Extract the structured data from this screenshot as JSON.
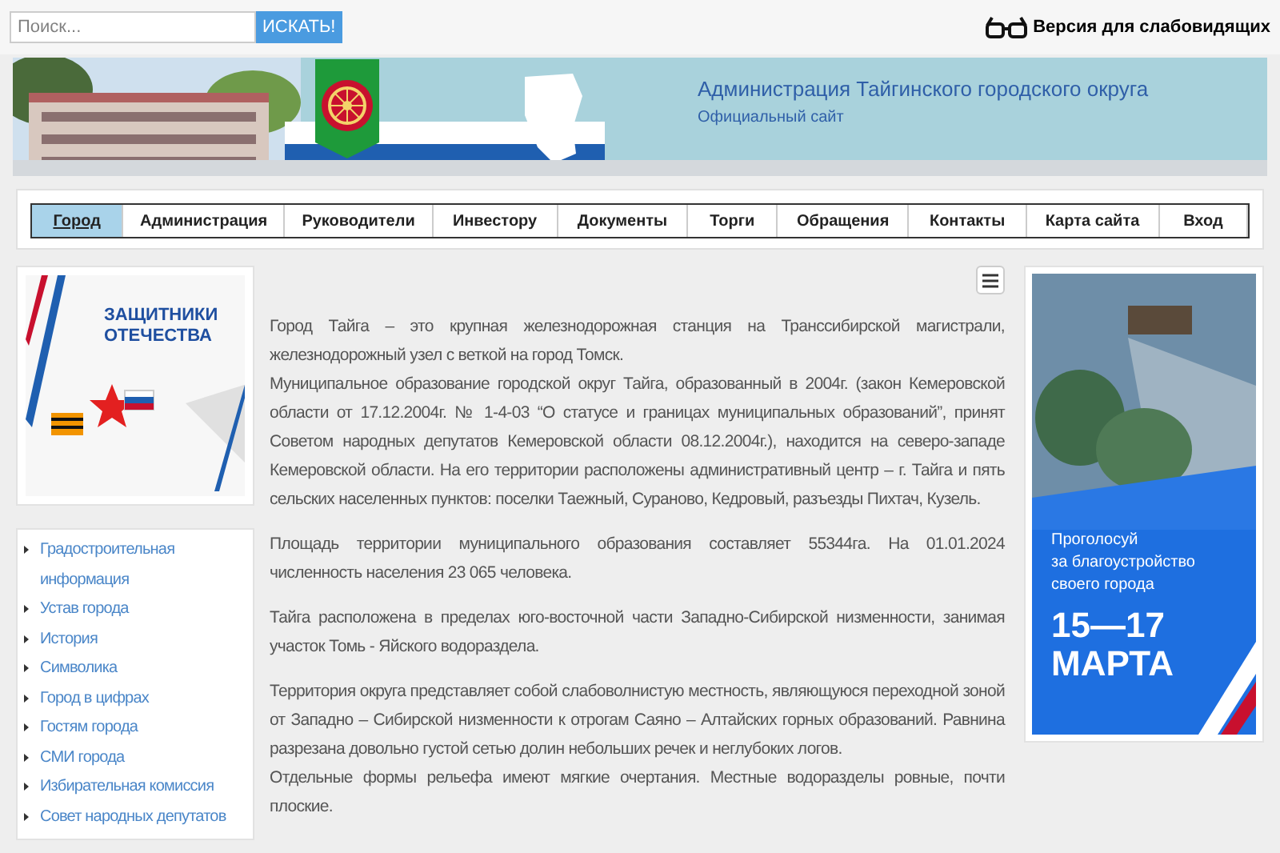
{
  "search": {
    "placeholder": "Поиск...",
    "button": "ИСКАТЬ!"
  },
  "accessibility_link": "Версия для слабовидящих",
  "header": {
    "title": "Администрация Тайгинского городского округа",
    "subtitle": "Официальный сайт"
  },
  "nav": [
    {
      "label": "Город",
      "selected": true
    },
    {
      "label": "Администрация",
      "selected": false
    },
    {
      "label": "Руководители",
      "selected": false
    },
    {
      "label": "Инвестору",
      "selected": false
    },
    {
      "label": "Документы",
      "selected": false
    },
    {
      "label": "Торги",
      "selected": false
    },
    {
      "label": "Обращения",
      "selected": false
    },
    {
      "label": "Контакты",
      "selected": false
    },
    {
      "label": "Карта сайта",
      "selected": false
    },
    {
      "label": "Вход",
      "selected": false
    }
  ],
  "left_banner": {
    "title": "ЗАЩИТНИКИ ОТЕЧЕСТВА"
  },
  "sidebar": {
    "items": [
      "Градостроительная информация",
      "Устав города",
      "История",
      "Символика",
      "Город в цифрах",
      "Гостям города",
      "СМИ города",
      "Избирательная комиссия",
      "Совет народных депутатов"
    ]
  },
  "article": {
    "paragraphs": [
      [
        "Город Тайга – это крупная железнодорожная станция на Транссибирской магистрали, железнодорожный узел с веткой на город Томск.",
        "Муниципальное образование городской округ Тайга, образованный в 2004г. (закон Кемеровской области от 17.12.2004г. № 1-4-03 “О статусе и границах муниципальных образований”, принят Советом народных депутатов Кемеровской области 08.12.2004г.), находится на северо-западе Кемеровской области. На его территории расположены административный центр – г. Тайга и пять сельских населенных пунктов: поселки Таежный, Сураново, Кедровый, разъезды Пихтач, Кузель."
      ],
      [
        "Площадь территории муниципального образования составляет 55344га. На 01.01.2024 численность населения 23 065 человека."
      ],
      [
        "Тайга расположена в пределах юго-восточной части Западно-Сибирской низменности, занимая участок Томь - Яйского водораздела."
      ],
      [
        "Территория округа представляет собой слабоволнистую местность, являющуюся переходной зоной от Западно – Сибирской низменности к отрогам Саяно – Алтайских горных образований. Равнина разрезана довольно густой сетью долин небольших речек и неглубоких логов.",
        "Отдельные формы рельефа имеют мягкие очертания. Местные водоразделы ровные, почти плоские."
      ]
    ]
  },
  "right_banner": {
    "lines": [
      "Проголосуй",
      "за благоустройство",
      "своего города"
    ],
    "dates": "15—17",
    "month": "МАРТА"
  }
}
